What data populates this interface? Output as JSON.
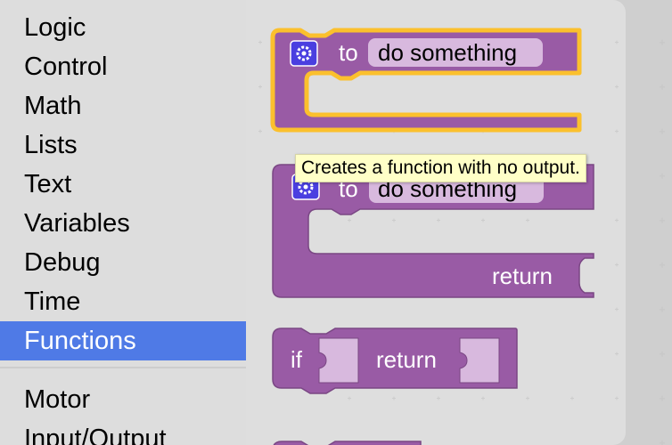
{
  "toolbox": {
    "categories": [
      "Logic",
      "Control",
      "Math",
      "Lists",
      "Text",
      "Variables",
      "Debug",
      "Time",
      "Functions",
      "Motor",
      "Input/Output"
    ],
    "selected_index": 8
  },
  "flyout": {
    "block1": {
      "to_label": "to",
      "name_field": "do something",
      "icon": "gear-icon"
    },
    "block2": {
      "to_label": "to",
      "name_field": "do something",
      "return_label": "return",
      "icon": "gear-icon"
    },
    "block3": {
      "if_label": "if",
      "return_label": "return"
    }
  },
  "tooltip": {
    "text": "Creates a function with no output."
  },
  "colors": {
    "block": "#995ba5",
    "block_shadow": "#7a4784",
    "highlight": "#fbc02d",
    "selected_category": "#4f7ae6",
    "tooltip_bg": "#ffffc7"
  }
}
